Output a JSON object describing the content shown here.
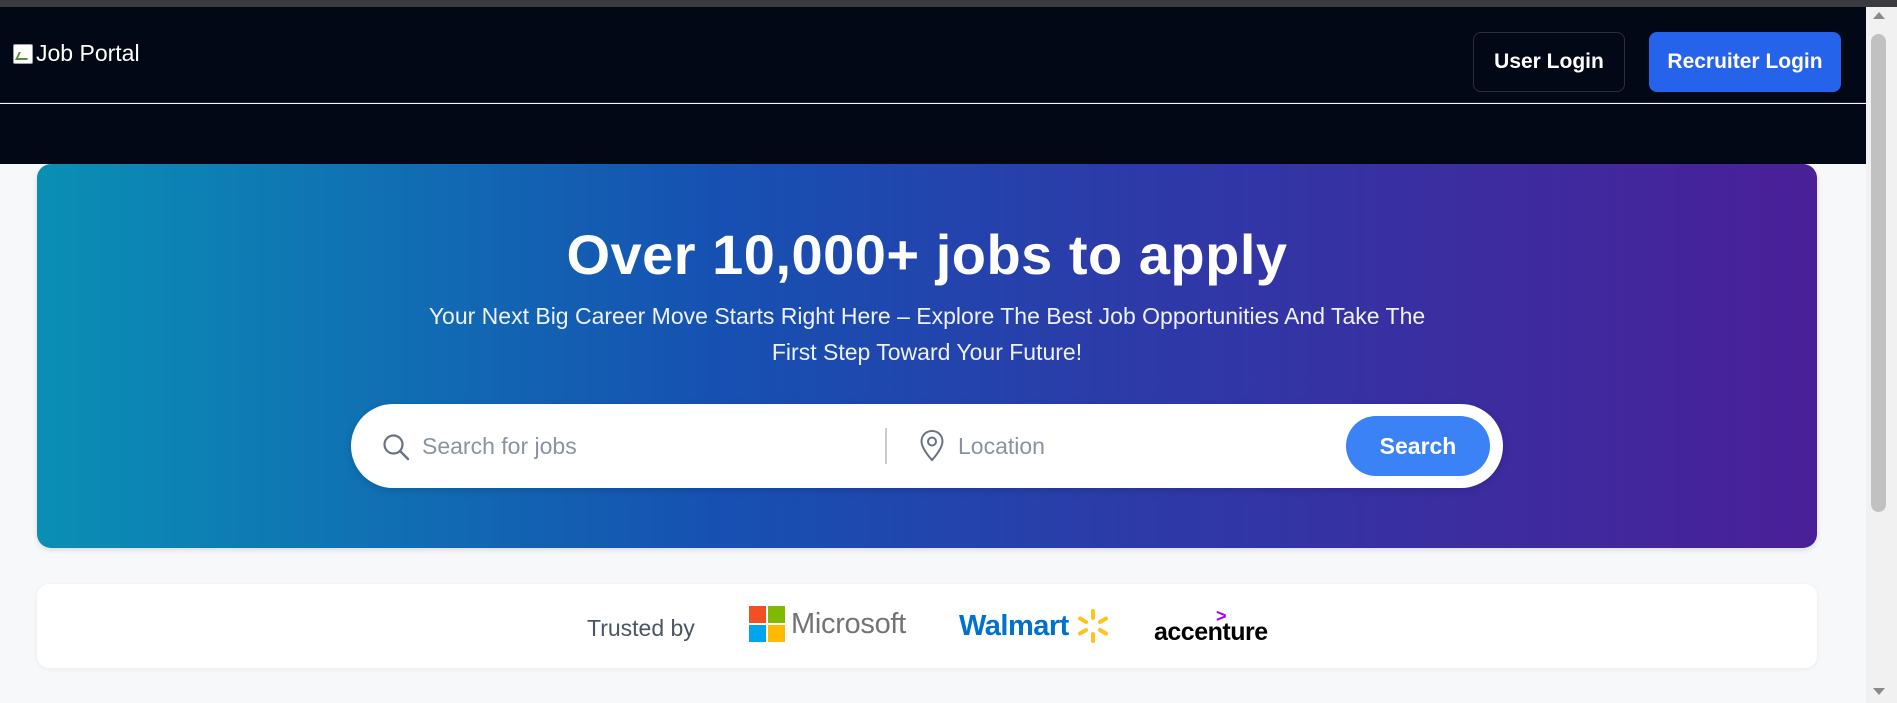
{
  "header": {
    "logo_alt": "Job Portal",
    "user_login": "User Login",
    "recruiter_login": "Recruiter Login"
  },
  "hero": {
    "title": "Over 10,000+ jobs to apply",
    "subtitle": "Your Next Big Career Move Starts Right Here – Explore The Best Job Opportunities And Take The First Step Toward Your Future!",
    "search": {
      "placeholder": "Search for jobs",
      "icon": "search-icon"
    },
    "location": {
      "placeholder": "Location",
      "icon": "location-pin-icon"
    },
    "search_button": "Search"
  },
  "trusted": {
    "label": "Trusted by",
    "companies": [
      "Microsoft",
      "Walmart",
      "accenture"
    ]
  },
  "colors": {
    "nav_bg": "#030817",
    "primary": "#2563eb",
    "search_button": "#3b82f6",
    "hero_gradient_start": "#0a8fb4",
    "hero_gradient_end": "#4a1f98"
  }
}
